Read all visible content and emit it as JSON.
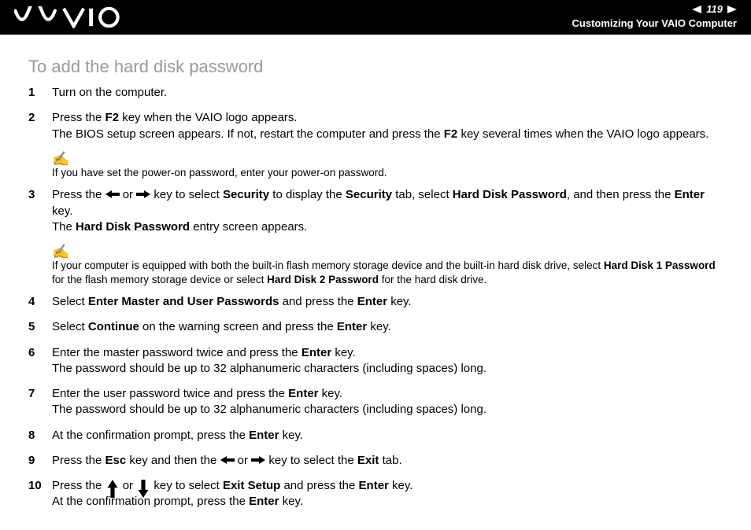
{
  "header": {
    "page_number": "119",
    "breadcrumb": "Customizing Your VAIO Computer"
  },
  "title": "To add the hard disk password",
  "steps": {
    "s1": {
      "num": "1",
      "text": "Turn on the computer."
    },
    "s2": {
      "num": "2",
      "line1_a": "Press the ",
      "line1_b": "F2",
      "line1_c": " key when the VAIO logo appears.",
      "line2_a": "The BIOS setup screen appears. If not, restart the computer and press the ",
      "line2_b": "F2",
      "line2_c": " key several times when the VAIO logo appears."
    },
    "s3": {
      "num": "3",
      "a": "Press the ",
      "b": " or ",
      "c": " key to select ",
      "d": "Security",
      "e": " to display the ",
      "f": "Security",
      "g": " tab, select ",
      "h": "Hard Disk Password",
      "i": ", and then press the ",
      "j": "Enter",
      "k": " key.",
      "l": "The ",
      "m": "Hard Disk Password",
      "n": " entry screen appears."
    },
    "s4": {
      "num": "4",
      "a": "Select ",
      "b": "Enter Master and User Passwords",
      "c": " and press the ",
      "d": "Enter",
      "e": " key."
    },
    "s5": {
      "num": "5",
      "a": "Select ",
      "b": "Continue",
      "c": " on the warning screen and press the ",
      "d": "Enter",
      "e": " key."
    },
    "s6": {
      "num": "6",
      "a": "Enter the master password twice and press the ",
      "b": "Enter",
      "c": " key.",
      "d": "The password should be up to 32 alphanumeric characters (including spaces) long."
    },
    "s7": {
      "num": "7",
      "a": "Enter the user password twice and press the ",
      "b": "Enter",
      "c": " key.",
      "d": "The password should be up to 32 alphanumeric characters (including spaces) long."
    },
    "s8": {
      "num": "8",
      "a": "At the confirmation prompt, press the ",
      "b": "Enter",
      "c": " key."
    },
    "s9": {
      "num": "9",
      "a": "Press the ",
      "b": "Esc",
      "c": " key and then the ",
      "d": " or ",
      "e": " key to select the ",
      "f": "Exit",
      "g": " tab."
    },
    "s10": {
      "num": "10",
      "a": "Press the ",
      "b": " or ",
      "c": " key to select ",
      "d": "Exit Setup",
      "e": " and press the ",
      "f": "Enter",
      "g": " key.",
      "h": "At the confirmation prompt, press the ",
      "i": "Enter",
      "j": " key."
    }
  },
  "notes": {
    "n1": "If you have set the power-on password, enter your power-on password.",
    "n2": {
      "a": "If your computer is equipped with both the built-in flash memory storage device and the built-in hard disk drive, select ",
      "b": "Hard Disk 1 Password",
      "c": " for the flash memory storage device or select ",
      "d": "Hard Disk 2 Password",
      "e": " for the hard disk drive."
    }
  },
  "icons": {
    "note_glyph": "✍"
  }
}
